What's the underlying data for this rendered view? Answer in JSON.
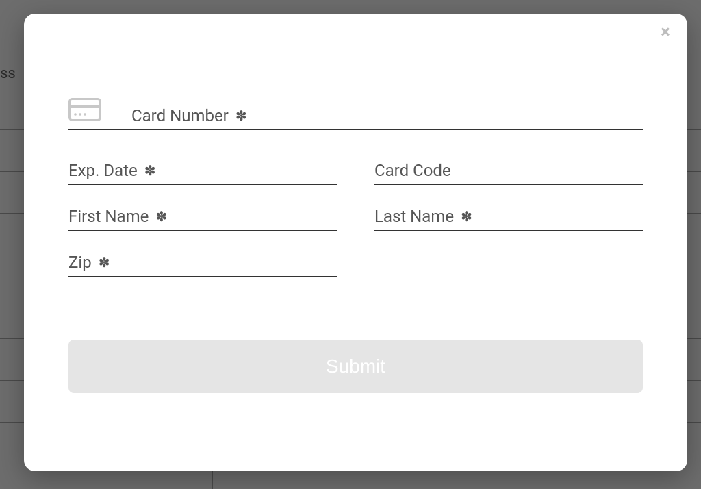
{
  "background": {
    "partial_text": "ss"
  },
  "form": {
    "card_number_label": "Card Number",
    "exp_date_label": "Exp. Date",
    "card_code_label": "Card Code",
    "first_name_label": "First Name",
    "last_name_label": "Last Name",
    "zip_label": "Zip",
    "required_marker": "✽",
    "submit_label": "Submit"
  }
}
